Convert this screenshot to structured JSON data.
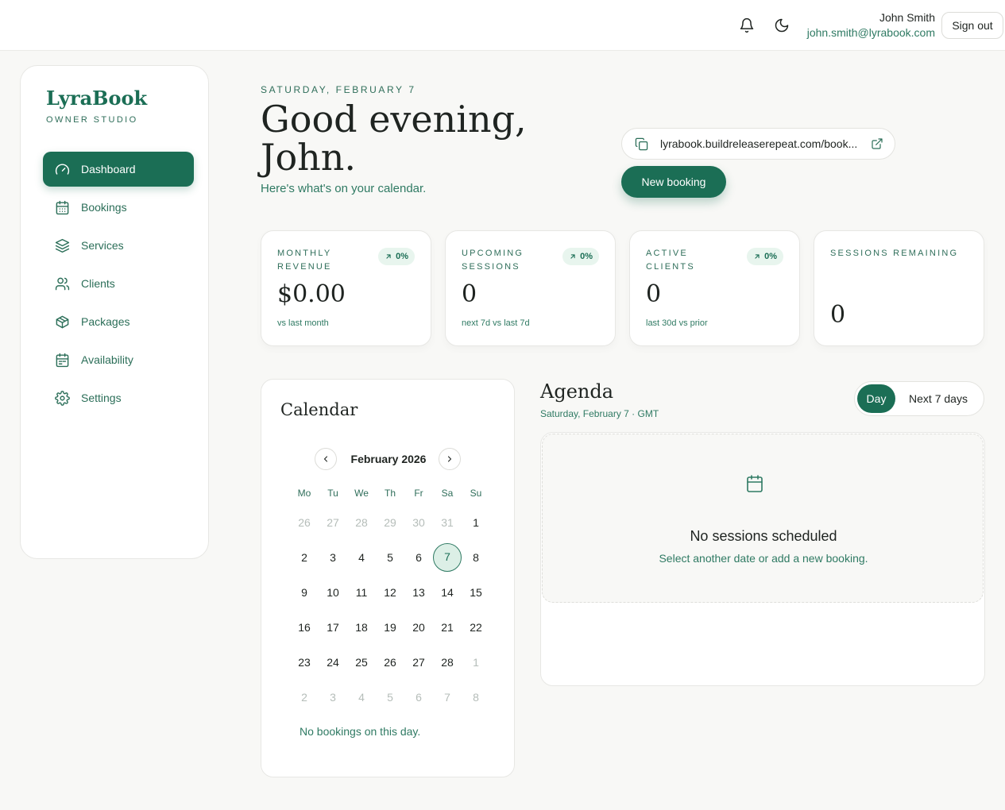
{
  "header": {
    "user_name": "John Smith",
    "user_email": "john.smith@lyrabook.com",
    "sign_out_label": "Sign out",
    "icons": [
      "bell-icon",
      "moon-icon"
    ]
  },
  "sidebar": {
    "brand": "LyraBook",
    "brand_sub": "OWNER STUDIO",
    "items": [
      {
        "label": "Dashboard",
        "icon": "gauge-icon",
        "active": true
      },
      {
        "label": "Bookings",
        "icon": "calendar-icon"
      },
      {
        "label": "Services",
        "icon": "layers-icon"
      },
      {
        "label": "Clients",
        "icon": "users-icon"
      },
      {
        "label": "Packages",
        "icon": "package-icon"
      },
      {
        "label": "Availability",
        "icon": "calendar-grid-icon"
      },
      {
        "label": "Settings",
        "icon": "gear-icon"
      }
    ]
  },
  "greeting": {
    "date": "SATURDAY, FEBRUARY 7",
    "title": "Good evening, John.",
    "subtitle": "Here's what's on your calendar."
  },
  "booking_link": {
    "url": "lyrabook.buildreleaserepeat.com/book..."
  },
  "new_booking_label": "New booking",
  "stats": [
    {
      "label": "MONTHLY REVENUE",
      "badge": "0%",
      "value": "$0.00",
      "note": "vs last month"
    },
    {
      "label": "UPCOMING SESSIONS",
      "badge": "0%",
      "value": "0",
      "note": "next 7d vs last 7d"
    },
    {
      "label": "ACTIVE CLIENTS",
      "badge": "0%",
      "value": "0",
      "note": "last 30d vs prior"
    },
    {
      "label": "SESSIONS REMAINING",
      "value": "0"
    }
  ],
  "calendar": {
    "title": "Calendar",
    "month": "February 2026",
    "weekdays": [
      "Mo",
      "Tu",
      "We",
      "Th",
      "Fr",
      "Sa",
      "Su"
    ],
    "weeks": [
      [
        {
          "d": "26",
          "m": true
        },
        {
          "d": "27",
          "m": true
        },
        {
          "d": "28",
          "m": true
        },
        {
          "d": "29",
          "m": true
        },
        {
          "d": "30",
          "m": true
        },
        {
          "d": "31",
          "m": true
        },
        {
          "d": "1"
        }
      ],
      [
        {
          "d": "2"
        },
        {
          "d": "3"
        },
        {
          "d": "4"
        },
        {
          "d": "5"
        },
        {
          "d": "6"
        },
        {
          "d": "7",
          "sel": true
        },
        {
          "d": "8"
        }
      ],
      [
        {
          "d": "9"
        },
        {
          "d": "10"
        },
        {
          "d": "11"
        },
        {
          "d": "12"
        },
        {
          "d": "13"
        },
        {
          "d": "14"
        },
        {
          "d": "15"
        }
      ],
      [
        {
          "d": "16"
        },
        {
          "d": "17"
        },
        {
          "d": "18"
        },
        {
          "d": "19"
        },
        {
          "d": "20"
        },
        {
          "d": "21"
        },
        {
          "d": "22"
        }
      ],
      [
        {
          "d": "23"
        },
        {
          "d": "24"
        },
        {
          "d": "25"
        },
        {
          "d": "26"
        },
        {
          "d": "27"
        },
        {
          "d": "28"
        },
        {
          "d": "1",
          "m": true
        }
      ],
      [
        {
          "d": "2",
          "m": true
        },
        {
          "d": "3",
          "m": true
        },
        {
          "d": "4",
          "m": true
        },
        {
          "d": "5",
          "m": true
        },
        {
          "d": "6",
          "m": true
        },
        {
          "d": "7",
          "m": true
        },
        {
          "d": "8",
          "m": true
        }
      ]
    ],
    "empty_text": "No bookings on this day."
  },
  "agenda": {
    "title": "Agenda",
    "subtitle": "Saturday, February 7 · GMT",
    "toggle": [
      "Day",
      "Next 7 days"
    ],
    "empty_title": "No sessions scheduled",
    "empty_text": "Select another date or add a new booking."
  },
  "colors": {
    "accent": "#1b6e55",
    "accent_text": "#2f7a63",
    "background": "#f8f8f6"
  }
}
